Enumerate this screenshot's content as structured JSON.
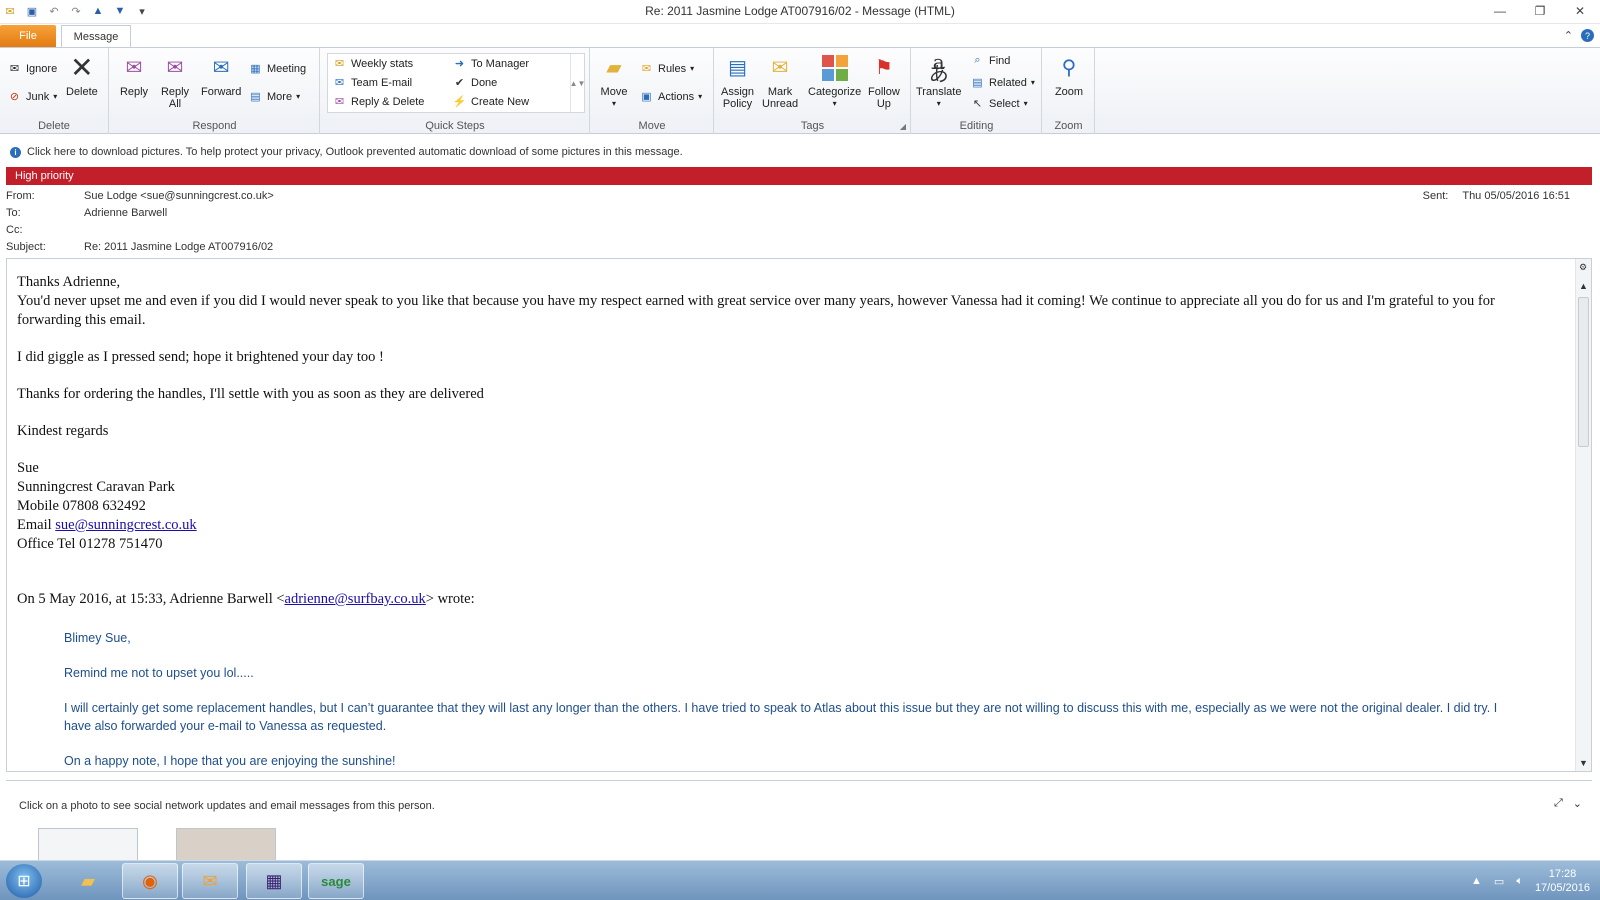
{
  "window": {
    "title": "Re: 2011 Jasmine Lodge AT007916/02 - Message (HTML)"
  },
  "qat": {
    "icons": [
      "envelope-icon",
      "save-icon",
      "undo-icon",
      "redo-icon",
      "up-arrow-icon",
      "down-arrow-icon",
      "customize-icon"
    ]
  },
  "tabs": {
    "file": "File",
    "message": "Message"
  },
  "ribbon": {
    "delete_group": {
      "label": "Delete",
      "ignore": "Ignore",
      "junk": "Junk",
      "delete": "Delete"
    },
    "respond_group": {
      "label": "Respond",
      "reply": "Reply",
      "reply_all_1": "Reply",
      "reply_all_2": "All",
      "forward": "Forward",
      "meeting": "Meeting",
      "more": "More"
    },
    "quicksteps_group": {
      "label": "Quick Steps",
      "items": [
        "Weekly stats",
        "To Manager",
        "Team E-mail",
        "Done",
        "Reply & Delete",
        "Create New"
      ]
    },
    "move_group": {
      "label": "Move",
      "move": "Move",
      "rules": "Rules",
      "actions": "Actions"
    },
    "tags_group": {
      "label": "Tags",
      "assign_policy_1": "Assign",
      "assign_policy_2": "Policy",
      "mark_unread_1": "Mark",
      "mark_unread_2": "Unread",
      "categorize": "Categorize",
      "follow_up_1": "Follow",
      "follow_up_2": "Up"
    },
    "editing_group": {
      "label": "Editing",
      "translate": "Translate",
      "find": "Find",
      "related": "Related",
      "select": "Select"
    },
    "zoom_group": {
      "label": "Zoom",
      "zoom": "Zoom"
    }
  },
  "infobar": {
    "text": "Click here to download pictures. To help protect your privacy, Outlook prevented automatic download of some pictures in this message."
  },
  "priority": {
    "text": "High priority"
  },
  "header": {
    "from_label": "From:",
    "from": "Sue Lodge <sue@sunningcrest.co.uk>",
    "to_label": "To:",
    "to": "Adrienne Barwell",
    "cc_label": "Cc:",
    "cc": "",
    "subject_label": "Subject:",
    "subject": "Re: 2011 Jasmine Lodge AT007916/02",
    "sent_label": "Sent:",
    "sent": "Thu 05/05/2016 16:51"
  },
  "body": {
    "greeting": "Thanks Adrienne,",
    "para1": "You'd never upset me and even if you did I would never speak to you like that because you have my respect earned with great service over many years, however Vanessa had it coming! We continue to appreciate all you do for us and I'm grateful to you for forwarding this email.",
    "para2": "I did giggle as I pressed send; hope it brightened your day too !",
    "para3": "Thanks for ordering the handles, I'll settle with you as soon as they are delivered",
    "signoff": "Kindest regards",
    "sig_name": "Sue",
    "sig_company": "Sunningcrest Caravan Park",
    "sig_mobile": "Mobile 07808 632492",
    "sig_email_label": "Email ",
    "sig_email": "sue@sunningcrest.co.uk",
    "sig_office": "Office Tel 01278 751470",
    "quote_intro_pre": "On 5 May 2016, at 15:33, Adrienne Barwell <",
    "quote_intro_email": "adrienne@surfbay.co.uk",
    "quote_intro_post": "> wrote:",
    "q1": "Blimey Sue,",
    "q2": "Remind me not to upset you lol.....",
    "q3": "I will certainly get some replacement handles, but I can’t guarantee that they will last any longer than the others.  I have tried to speak to Atlas about this issue but they are not willing to discuss this with me, especially as we were not the original dealer.  I did try.  I have also forwarded your e-mail to Vanessa  as requested.",
    "q4": "On a happy note, I  hope that you are enjoying the sunshine!"
  },
  "people_pane": {
    "message": "Click on a photo to see social network updates and email messages from this person."
  },
  "taskbar": {
    "time": "17:28",
    "date": "17/05/2016"
  }
}
